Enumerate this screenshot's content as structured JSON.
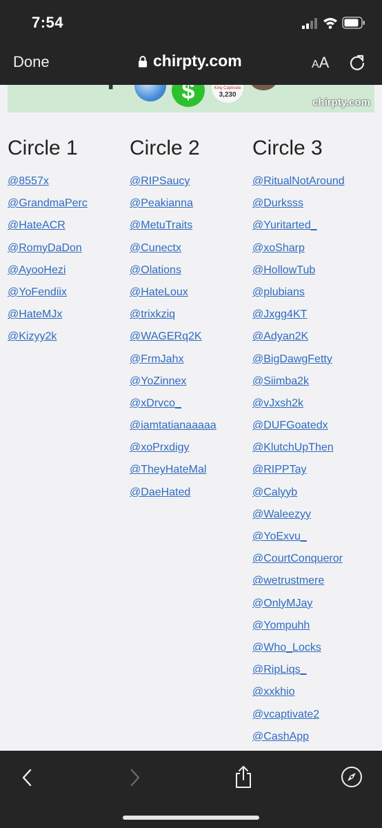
{
  "status_bar": {
    "time": "7:54"
  },
  "browser": {
    "done_label": "Done",
    "url": "chirpty.com",
    "text_size_small": "A",
    "text_size_large": "A"
  },
  "banner": {
    "cash_symbol": "$",
    "badge_name": "King Captivate",
    "badge_count": "3,230",
    "watermark": "chirpty.com"
  },
  "circles": [
    {
      "title": "Circle 1",
      "handles": [
        "@8557x",
        "@GrandmaPerc",
        "@HateACR",
        "@RomyDaDon",
        "@AyooHezi",
        "@YoFendiix",
        "@HateMJx",
        "@Kizyy2k"
      ]
    },
    {
      "title": "Circle 2",
      "handles": [
        "@RIPSaucy",
        "@Peakianna",
        "@MetuTraits",
        "@Cunectx",
        "@Olations",
        "@HateLoux",
        "@trixkziq",
        "@WAGERq2K",
        "@FrmJahx",
        "@YoZinnex",
        "@xDrvco_",
        "@iamtatianaaaaa",
        "@xoPrxdigy",
        "@TheyHateMal",
        "@DaeHated"
      ]
    },
    {
      "title": "Circle 3",
      "handles": [
        "@RitualNotAround",
        "@Durksss",
        "@Yuritarted_",
        "@xoSharp",
        "@HollowTub",
        "@plubians",
        "@Jxgg4KT",
        "@Adyan2K",
        "@BigDawgFetty",
        "@Siimba2k",
        "@vJxsh2k",
        "@DUFGoatedx",
        "@KlutchUpThen",
        "@RIPPTay",
        "@Calyyb",
        "@Waleezyy",
        "@YoExvu_",
        "@CourtConqueror",
        "@wetrustmere",
        "@OnlyMJay",
        "@Yompuhh",
        "@Who_Locks",
        "@RipLiqs_",
        "@xxkhio",
        "@vcaptivate2",
        "@CashApp"
      ]
    }
  ]
}
